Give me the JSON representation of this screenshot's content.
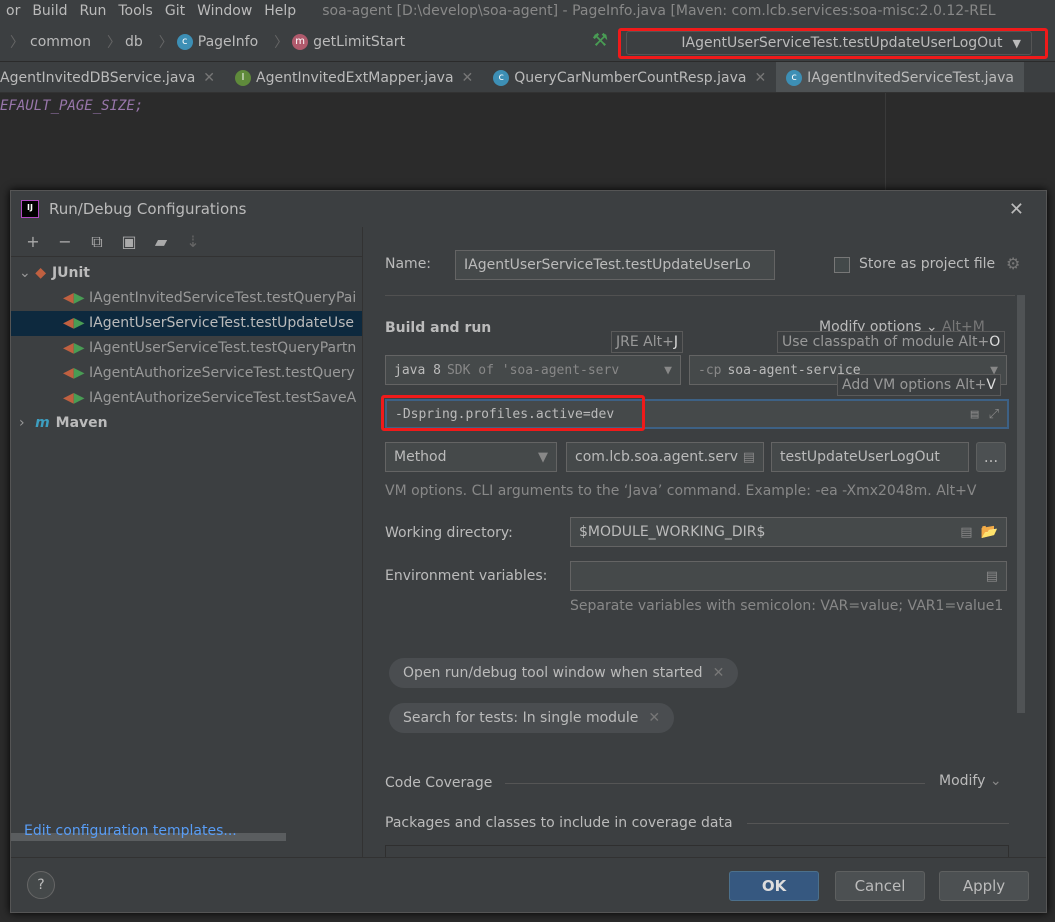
{
  "menu": {
    "items": [
      "or",
      "Build",
      "Run",
      "Tools",
      "Git",
      "Window",
      "Help"
    ],
    "title": "soa-agent [D:\\develop\\soa-agent] - PageInfo.java [Maven: com.lcb.services:soa-misc:2.0.12-REL"
  },
  "breadcrumb": [
    "common",
    "db",
    "PageInfo",
    "getLimitStart"
  ],
  "run_config": "IAgentUserServiceTest.testUpdateUserLogOut",
  "tabs": [
    "AgentInvitedDBService.java",
    "AgentInvitedExtMapper.java",
    "QueryCarNumberCountResp.java",
    "IAgentInvitedServiceTest.java"
  ],
  "code_line": "EFAULT_PAGE_SIZE;",
  "dialog": {
    "title": "Run/Debug Configurations",
    "tree": {
      "junit": "JUnit",
      "items": [
        "IAgentInvitedServiceTest.testQueryPai",
        "IAgentUserServiceTest.testUpdateUse",
        "IAgentUserServiceTest.testQueryPartn",
        "IAgentAuthorizeServiceTest.testQuery",
        "IAgentAuthorizeServiceTest.testSaveA"
      ],
      "maven": "Maven"
    },
    "edit_templates": "Edit configuration templates...",
    "name_label": "Name:",
    "name_value": "IAgentUserServiceTest.testUpdateUserLo",
    "store_label": "Store as project file",
    "build_run": "Build and run",
    "modify_options": "Modify options",
    "modify_shortcut": "Alt+M",
    "hint_jre": {
      "text": "JRE Alt+",
      "key": "J"
    },
    "hint_cp": {
      "text": "Use classpath of module Alt+",
      "key": "O"
    },
    "hint_vm": {
      "text": "Add VM options Alt+",
      "key": "V"
    },
    "jre_prefix": "java 8",
    "jre_rest": "SDK of 'soa-agent-serv",
    "cp_prefix": "-cp",
    "cp_value": "soa-agent-service",
    "vm_options": "-Dspring.profiles.active=dev",
    "test_kind": "Method",
    "class_value": "com.lcb.soa.agent.serv",
    "method_value": "testUpdateUserLogOut",
    "more": "...",
    "vm_help": "VM options. CLI arguments to the ‘Java’ command. Example: -ea -Xmx2048m. Alt+V",
    "workdir_label": "Working directory:",
    "workdir_value": "$MODULE_WORKING_DIR$",
    "env_label": "Environment variables:",
    "env_value": "",
    "env_help": "Separate variables with semicolon: VAR=value; VAR1=value1",
    "chips": [
      "Open run/debug tool window when started",
      "Search for tests: In single module"
    ],
    "coverage": "Code Coverage",
    "coverage_modify": "Modify",
    "packages": "Packages and classes to include in coverage data",
    "ok": "OK",
    "cancel": "Cancel",
    "apply": "Apply",
    "help": "?"
  },
  "colors": {
    "highlight": "#f01a1a",
    "accent": "#589df6",
    "selection": "#0d293e"
  }
}
